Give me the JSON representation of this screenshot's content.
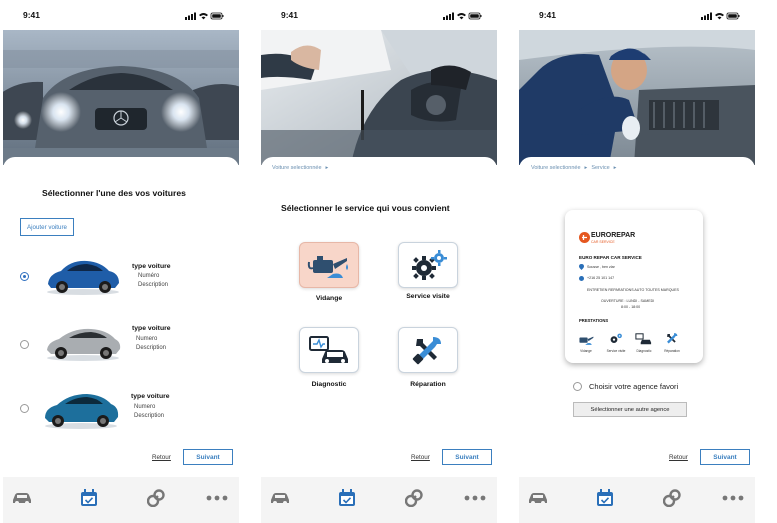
{
  "status": {
    "time": "9:41"
  },
  "screen1": {
    "title": "Sélectionner l'une des vos voitures",
    "add_car": "Ajouter voiture",
    "cars": [
      {
        "name": "type voiture",
        "line1": "Numéro",
        "line2": "Description",
        "selected": true,
        "color": "#1f5da8"
      },
      {
        "name": "type voiture",
        "line1": "Numero",
        "line2": "Description",
        "selected": false,
        "color": "#a9adb1"
      },
      {
        "name": "type voiture",
        "line1": "Numero",
        "line2": "Description",
        "selected": false,
        "color": "#1d6f9c"
      }
    ],
    "back": "Retour",
    "next": "Suivant"
  },
  "screen2": {
    "breadcrumb": [
      "Voiture selectionnée",
      "▸"
    ],
    "title": "Sélectionner le service qui vous convient",
    "services": [
      {
        "label": "Vidange",
        "icon": "oil-can-icon",
        "selected": true
      },
      {
        "label": "Service visite",
        "icon": "gears-icon",
        "selected": false
      },
      {
        "label": "Diagnostic",
        "icon": "diagnostic-icon",
        "selected": false
      },
      {
        "label": "Réparation",
        "icon": "tools-icon",
        "selected": false
      }
    ],
    "back": "Retour",
    "next": "Suivant"
  },
  "screen3": {
    "breadcrumb": [
      "Voiture selectionnée",
      "▸",
      "Service",
      "▸"
    ],
    "card": {
      "brand": "EUROREPAR",
      "brand_sub": "CAR SERVICE",
      "name": "EURO REPAR CAR SERVICE",
      "address": "Sousse , ben zlar",
      "phone": "+216 25 101 147",
      "desc": "ENTRETIEN REPARATIONS AUTO TOUTES MARQUES",
      "hours_label": "OUVERTURE : LUNDI - SAMEDI",
      "hours": "8:00 - 18:00",
      "prestations_label": "PRESTATIONS",
      "prestations": [
        "Vidange",
        "Service visite",
        "Diagnostic",
        "Réparation"
      ]
    },
    "choose_favorite": "Choisir votre agence favori",
    "other_agency": "Sélectionner une autre agence",
    "back": "Retour",
    "next": "Suivant"
  },
  "tabbar": [
    {
      "icon": "car-icon",
      "active": false
    },
    {
      "icon": "calendar-check-icon",
      "active": true
    },
    {
      "icon": "wrench-icon",
      "active": false
    },
    {
      "icon": "more-icon",
      "active": false
    }
  ],
  "colors": {
    "accent": "#3b7fbf",
    "selected_service": "#f8d6c9",
    "brand": "#e5571f",
    "tab_active": "#2a6fb8",
    "tab_inactive": "#777777"
  }
}
